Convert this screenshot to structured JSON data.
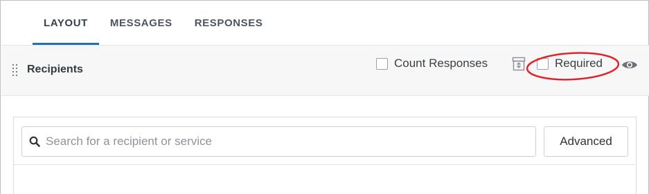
{
  "tabs": [
    {
      "label": "LAYOUT",
      "active": true
    },
    {
      "label": "MESSAGES",
      "active": false
    },
    {
      "label": "RESPONSES",
      "active": false
    }
  ],
  "section": {
    "title": "Recipients",
    "count_responses_label": "Count Responses",
    "count_responses_checked": false,
    "required_label": "Required",
    "required_checked": false
  },
  "search": {
    "placeholder": "Search for a recipient or service",
    "value": ""
  },
  "advanced_button_label": "Advanced",
  "colors": {
    "active_tab_underline": "#1a72bb",
    "highlight": "#e0242b"
  },
  "icons": [
    "drag-handle-icon",
    "archive-icon",
    "eye-icon",
    "search-icon"
  ]
}
